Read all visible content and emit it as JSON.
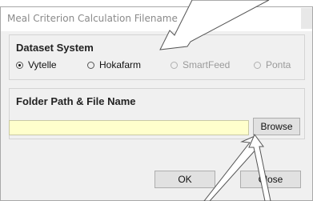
{
  "window": {
    "title": "Meal Criterion Calculation Filename"
  },
  "dataset_system": {
    "label": "Dataset System",
    "options": [
      {
        "label": "Vytelle",
        "selected": true,
        "enabled": true
      },
      {
        "label": "Hokafarm",
        "selected": false,
        "enabled": true
      },
      {
        "label": "SmartFeed",
        "selected": false,
        "enabled": false
      },
      {
        "label": "Ponta",
        "selected": false,
        "enabled": false
      }
    ]
  },
  "folder_path": {
    "label": "Folder Path & File Name",
    "value": "",
    "field_color": "#ffffcc",
    "browse_label": "Browse"
  },
  "footer": {
    "ok_label": "OK",
    "close_label": "Close"
  }
}
